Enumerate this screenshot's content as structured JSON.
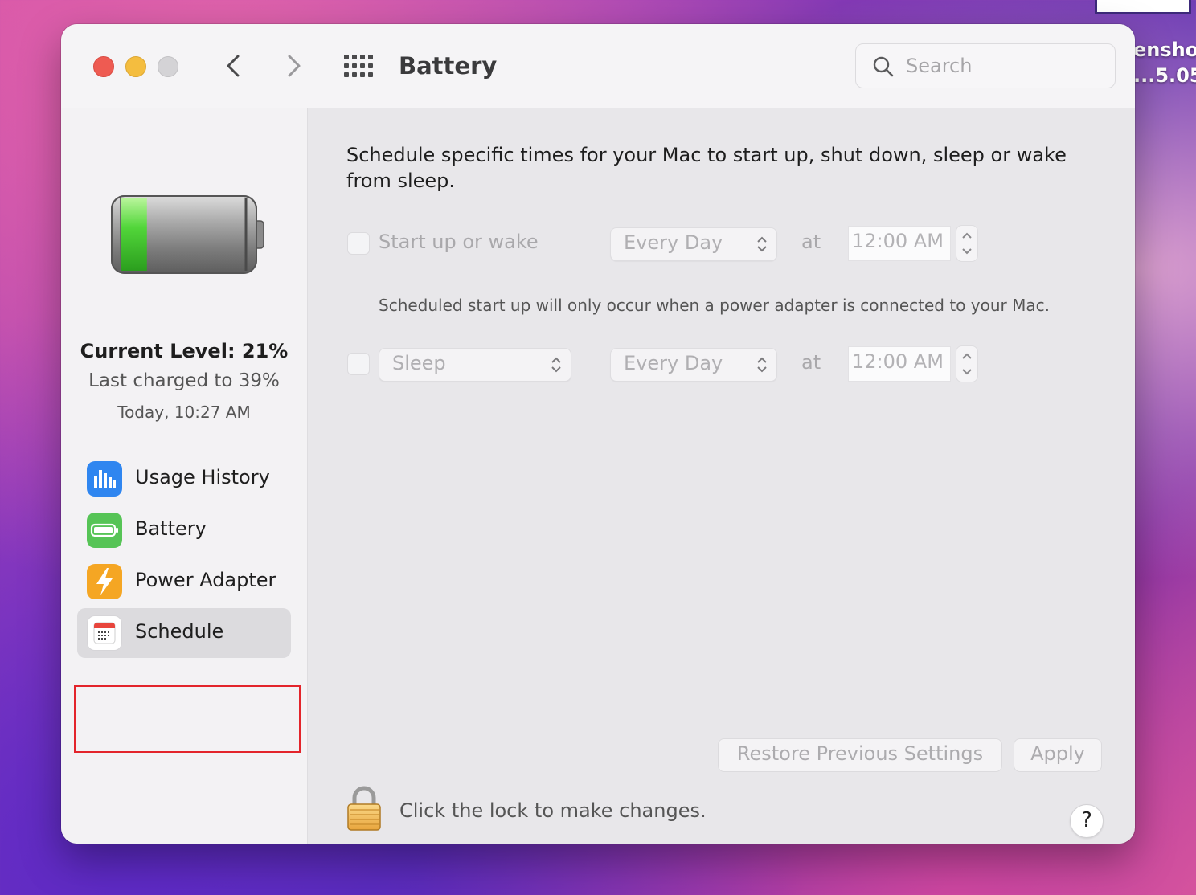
{
  "desktop": {
    "file_label_line1": "enshot",
    "file_label_line2": "...5.05"
  },
  "window": {
    "title": "Battery"
  },
  "search": {
    "placeholder": "Search"
  },
  "sidebar": {
    "current_level": "Current Level: 21%",
    "last_charged": "Last charged to 39%",
    "last_charged_time": "Today, 10:27 AM",
    "battery_fill_percent": 21,
    "items": [
      {
        "label": "Usage History",
        "icon": "bar-chart-icon",
        "color": "#2f86f0"
      },
      {
        "label": "Battery",
        "icon": "battery-icon",
        "color": "#56c456"
      },
      {
        "label": "Power Adapter",
        "icon": "lightning-icon",
        "color": "#f5a623"
      },
      {
        "label": "Schedule",
        "icon": "calendar-icon",
        "color": "#e8453c",
        "selected": true
      }
    ]
  },
  "schedule": {
    "description": "Schedule specific times for your Mac to start up, shut down, sleep or wake from sleep.",
    "row1": {
      "label": "Start up or wake",
      "frequency": "Every Day",
      "at": "at",
      "time": "12:00 AM",
      "checked": false
    },
    "note": "Scheduled start up will only occur when a power adapter is connected to your Mac.",
    "row2": {
      "action": "Sleep",
      "frequency": "Every Day",
      "at": "at",
      "time": "12:00 AM",
      "checked": false
    },
    "restore_label": "Restore Previous Settings",
    "apply_label": "Apply"
  },
  "footer": {
    "lock_text": "Click the lock to make changes.",
    "help_label": "?"
  }
}
